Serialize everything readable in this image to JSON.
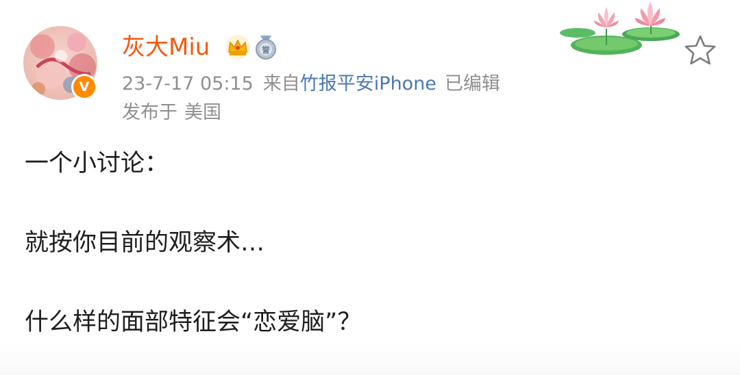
{
  "user": {
    "name": "灰大Miu",
    "verified_mark": "V"
  },
  "meta": {
    "time": "23-7-17 05:15",
    "source_prefix": "来自",
    "source": "竹报平安iPhone",
    "edited": "已编辑",
    "location_prefix": "发布于",
    "location": "美国"
  },
  "post": {
    "lines": [
      "一个小讨论：",
      "就按你目前的观察术…",
      "什么样的面部特征会“恋爱脑”？"
    ]
  },
  "icons": {
    "crown": "crown-icon",
    "medal": "medal-icon",
    "favorite": "star-outline-icon",
    "decoration": "lotus-decoration"
  },
  "colors": {
    "username": "#f2590f",
    "meta": "#8f8f8f",
    "link": "#4a78b0",
    "text": "#1e1e1e",
    "verified": "#ff8a00"
  }
}
